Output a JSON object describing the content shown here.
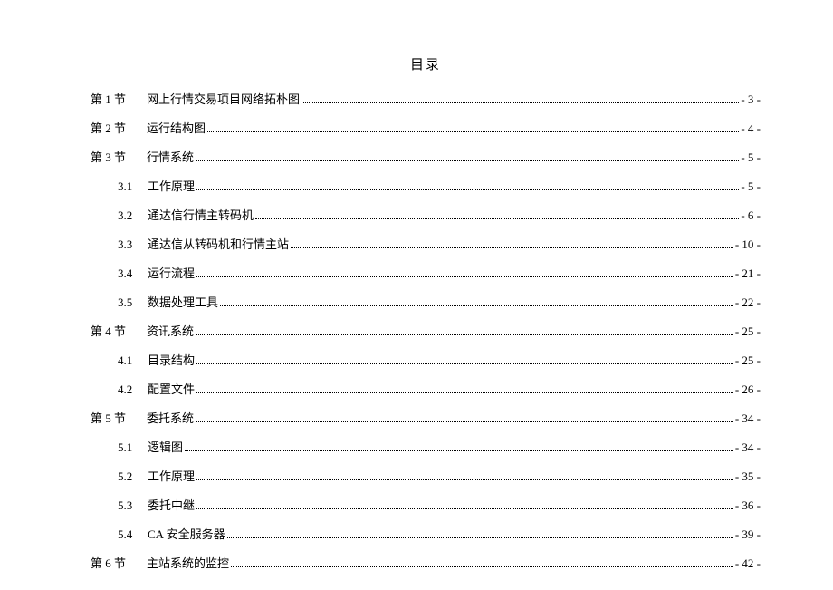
{
  "title": "目录",
  "entries": [
    {
      "level": 0,
      "label": "第 1 节",
      "title": "网上行情交易项目网络拓朴图",
      "page": "- 3 -"
    },
    {
      "level": 0,
      "label": "第 2 节",
      "title": "运行结构图",
      "page": "- 4 -"
    },
    {
      "level": 0,
      "label": "第 3 节",
      "title": "行情系统",
      "page": "- 5 -"
    },
    {
      "level": 1,
      "label": "3.1",
      "title": "工作原理",
      "page": "- 5 -"
    },
    {
      "level": 1,
      "label": "3.2",
      "title": "通达信行情主转码机",
      "page": "- 6 -"
    },
    {
      "level": 1,
      "label": "3.3",
      "title": "通达信从转码机和行情主站",
      "page": "- 10 -"
    },
    {
      "level": 1,
      "label": "3.4",
      "title": "运行流程",
      "page": "- 21 -"
    },
    {
      "level": 1,
      "label": "3.5",
      "title": "数据处理工具",
      "page": "- 22 -"
    },
    {
      "level": 0,
      "label": "第 4 节",
      "title": "资讯系统",
      "page": "- 25 -"
    },
    {
      "level": 1,
      "label": "4.1",
      "title": "目录结构",
      "page": "- 25 -"
    },
    {
      "level": 1,
      "label": "4.2",
      "title": "配置文件",
      "page": "- 26 -"
    },
    {
      "level": 0,
      "label": "第 5 节",
      "title": "委托系统",
      "page": "- 34 -"
    },
    {
      "level": 1,
      "label": "5.1",
      "title": "逻辑图",
      "page": "- 34 -"
    },
    {
      "level": 1,
      "label": "5.2",
      "title": "工作原理",
      "page": "- 35 -"
    },
    {
      "level": 1,
      "label": "5.3",
      "title": "委托中继",
      "page": "- 36 -"
    },
    {
      "level": 1,
      "label": "5.4",
      "title": "CA 安全服务器",
      "page": "- 39 -"
    },
    {
      "level": 0,
      "label": "第 6 节",
      "title": "主站系统的监控",
      "page": "- 42 -"
    }
  ]
}
